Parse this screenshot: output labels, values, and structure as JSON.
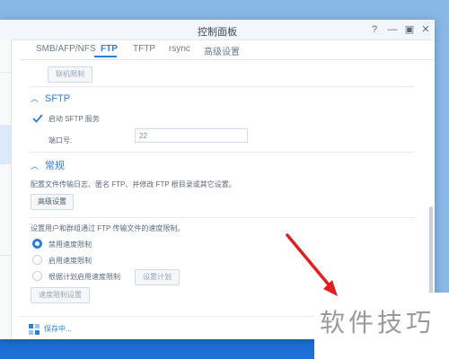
{
  "window": {
    "title": "控制面板",
    "controls": {
      "help": "?",
      "minimize": "—",
      "maximize": "▣",
      "close": "✕"
    }
  },
  "tabs": [
    {
      "label": "SMB/AFP/NFS",
      "active": false
    },
    {
      "label": "FTP",
      "active": true
    },
    {
      "label": "TFTP",
      "active": false
    },
    {
      "label": "rsync",
      "active": false
    },
    {
      "label": "高级设置",
      "active": false
    }
  ],
  "content": {
    "connection_limit_button": "联机限制",
    "sftp": {
      "heading": "SFTP",
      "enable_label": "启动 SFTP 服务",
      "enabled": true,
      "port_label": "端口号:",
      "port_value": "22"
    },
    "general": {
      "heading": "常规",
      "description1": "配置文件传输日志、匿名 FTP、并修改 FTP 根目录或其它设置。",
      "advanced_button": "高级设置",
      "description2": "设置用户和群组通过 FTP 传输文件的速度限制。",
      "speed_options": [
        {
          "label": "禁用速度限制",
          "selected": true
        },
        {
          "label": "启用速度限制",
          "selected": false
        },
        {
          "label": "根据计划启用速度限制",
          "selected": false
        }
      ],
      "schedule_button": "设置计划",
      "speed_limit_button": "速度限制设置"
    }
  },
  "footer": {
    "status": "保存中..."
  },
  "watermark": "软件技巧",
  "colors": {
    "accent": "#2d7ddb",
    "annotation_arrow": "#e02020"
  }
}
